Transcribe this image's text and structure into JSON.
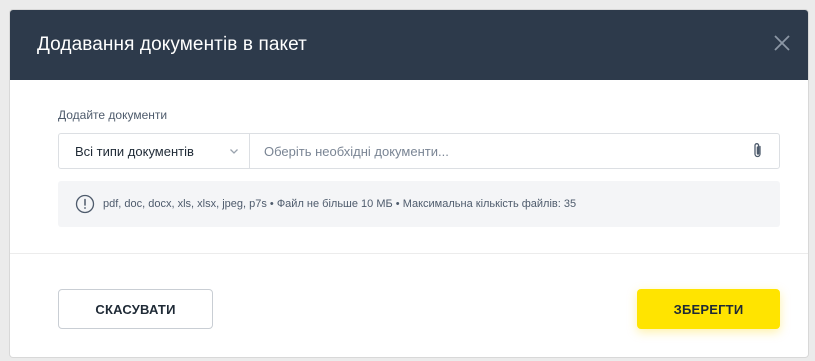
{
  "modal": {
    "title": "Додавання документів в пакет",
    "close_icon": "close-icon"
  },
  "body": {
    "section_label": "Додайте документи",
    "type_select": {
      "selected": "Всі типи документів",
      "icon": "chevron-down-icon"
    },
    "file_input": {
      "placeholder": "Оберіть необхідні документи...",
      "icon": "paperclip-icon"
    },
    "info": {
      "icon": "info-icon",
      "text": "pdf, doc, docx, xls, xlsx, jpeg, p7s • Файл не більше 10 МБ • Максимальна кількість файлів: 35"
    }
  },
  "footer": {
    "cancel_label": "СКАСУВАТИ",
    "save_label": "ЗБЕРЕГТИ"
  },
  "colors": {
    "header_bg": "#2d3a4b",
    "accent_yellow": "#ffe400",
    "info_bg": "#f4f5f7"
  }
}
